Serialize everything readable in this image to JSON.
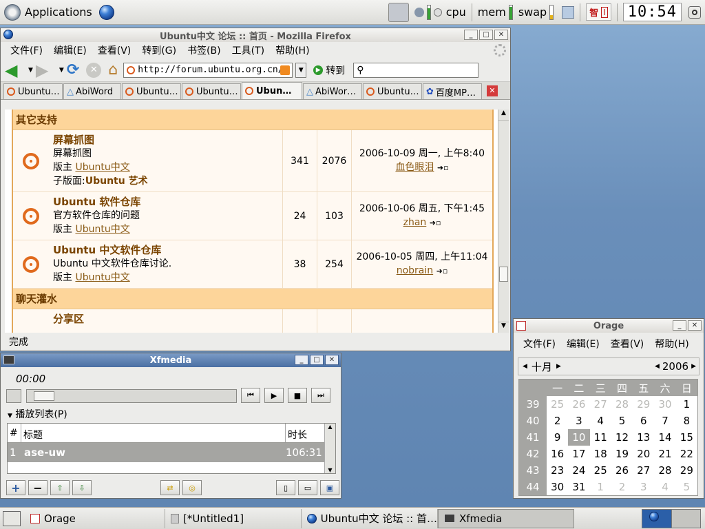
{
  "top_panel": {
    "applications_label": "Applications",
    "cpu_label": "cpu",
    "mem_label": "mem",
    "swap_label": "swap",
    "ime_chars": [
      "智",
      "I"
    ],
    "clock": "10:54"
  },
  "firefox": {
    "title": "Ubuntu中文 论坛 :: 首页 - Mozilla Firefox",
    "menus": [
      "文件(F)",
      "编辑(E)",
      "查看(V)",
      "转到(G)",
      "书签(B)",
      "工具(T)",
      "帮助(H)"
    ],
    "url": "http://forum.ubuntu.org.cn/i",
    "go_label": "转到",
    "tabs": [
      "Ubuntu…",
      "AbiWord",
      "Ubuntu…",
      "Ubuntu…",
      "Ubun…",
      "AbiWor…",
      "Ubuntu…",
      "百度MP…"
    ],
    "status": "完成",
    "forum": {
      "cat1": "其它支持",
      "cat2": "聊天灌水",
      "rows": [
        {
          "title": "屏幕抓图",
          "desc": "屏幕抓图",
          "moderator_prefix": "版主",
          "moderator": "Ubuntu中文",
          "sub_prefix": "子版面:",
          "sub": "Ubuntu 艺术",
          "topics": "341",
          "posts": "2076",
          "last_date": "2006-10-09 周一, 上午8:40",
          "last_user": "血色眼泪"
        },
        {
          "title": "Ubuntu 软件仓库",
          "desc": "官方软件仓库的问题",
          "moderator_prefix": "版主",
          "moderator": "Ubuntu中文",
          "topics": "24",
          "posts": "103",
          "last_date": "2006-10-06 周五, 下午1:45",
          "last_user": "zhan"
        },
        {
          "title": "Ubuntu 中文软件仓库",
          "desc": "Ubuntu 中文软件仓库讨论.",
          "moderator_prefix": "版主",
          "moderator": "Ubuntu中文",
          "topics": "38",
          "posts": "254",
          "last_date": "2006-10-05 周四, 上午11:04",
          "last_user": "nobrain"
        }
      ],
      "partial_row": "分享区"
    }
  },
  "xfmedia": {
    "title": "Xfmedia",
    "time": "00:00",
    "seek_fraction": 0.03,
    "playlist_label": "播放列表(P)",
    "col_num": "#",
    "col_title": "标题",
    "col_length": "时长",
    "items": [
      {
        "num": "1",
        "title": "ase-uw",
        "length": "106:31"
      }
    ]
  },
  "orage": {
    "title": "Orage",
    "menus": [
      "文件(F)",
      "编辑(E)",
      "查看(V)",
      "帮助(H)"
    ],
    "month": "十月",
    "year": "2006",
    "weekdays": [
      "一",
      "二",
      "三",
      "四",
      "五",
      "六",
      "日"
    ],
    "weeks": [
      {
        "wk": "39",
        "days": [
          "25",
          "26",
          "27",
          "28",
          "29",
          "30",
          "1"
        ],
        "dim": [
          true,
          true,
          true,
          true,
          true,
          true,
          false
        ]
      },
      {
        "wk": "40",
        "days": [
          "2",
          "3",
          "4",
          "5",
          "6",
          "7",
          "8"
        ],
        "dim": [
          false,
          false,
          false,
          false,
          false,
          false,
          false
        ]
      },
      {
        "wk": "41",
        "days": [
          "9",
          "10",
          "11",
          "12",
          "13",
          "14",
          "15"
        ],
        "dim": [
          false,
          false,
          false,
          false,
          false,
          false,
          false
        ]
      },
      {
        "wk": "42",
        "days": [
          "16",
          "17",
          "18",
          "19",
          "20",
          "21",
          "22"
        ],
        "dim": [
          false,
          false,
          false,
          false,
          false,
          false,
          false
        ]
      },
      {
        "wk": "43",
        "days": [
          "23",
          "24",
          "25",
          "26",
          "27",
          "28",
          "29"
        ],
        "dim": [
          false,
          false,
          false,
          false,
          false,
          false,
          false
        ]
      },
      {
        "wk": "44",
        "days": [
          "30",
          "31",
          "1",
          "2",
          "3",
          "4",
          "5"
        ],
        "dim": [
          false,
          false,
          true,
          true,
          true,
          true,
          true
        ]
      }
    ],
    "today": "10"
  },
  "taskbar": {
    "tasks": [
      {
        "label": "Orage",
        "active": false
      },
      {
        "label": "[*Untitled1]",
        "active": false
      },
      {
        "label": "Ubuntu中文 论坛 :: 首…",
        "active": false
      },
      {
        "label": "Xfmedia",
        "active": true
      }
    ]
  },
  "colors": {
    "accent": "#4a6fa3",
    "forum_header": "#fdd59a",
    "ubuntu_orange": "#e06a1d"
  }
}
